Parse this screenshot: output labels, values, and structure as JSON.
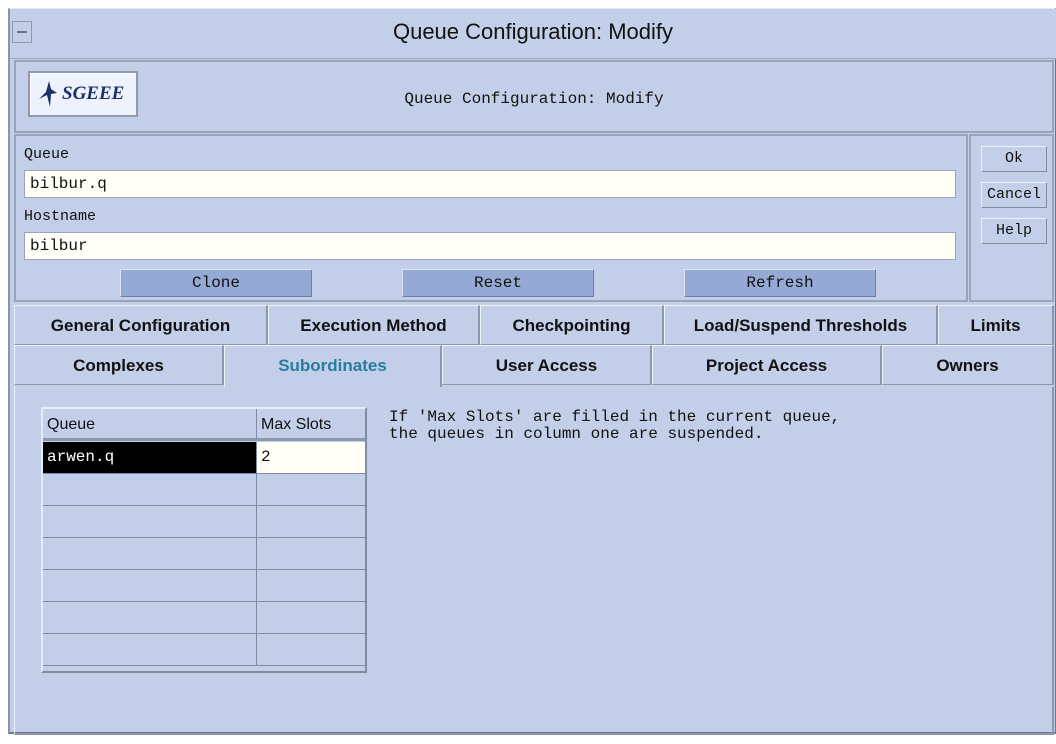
{
  "window": {
    "title": "Queue Configuration: Modify"
  },
  "header": {
    "logo_text": "SGEEE",
    "title": "Queue Configuration: Modify"
  },
  "form": {
    "queue_label": "Queue",
    "queue_value": "bilbur.q",
    "hostname_label": "Hostname",
    "hostname_value": "bilbur",
    "buttons": {
      "clone": "Clone",
      "reset": "Reset",
      "refresh": "Refresh"
    }
  },
  "side_buttons": {
    "ok": "Ok",
    "cancel": "Cancel",
    "help": "Help"
  },
  "tabs_row1": [
    "General Configuration",
    "Execution Method",
    "Checkpointing",
    "Load/Suspend Thresholds",
    "Limits"
  ],
  "tabs_row2": [
    "Complexes",
    "Subordinates",
    "User Access",
    "Project Access",
    "Owners"
  ],
  "active_tab": "Subordinates",
  "subordinates_table": {
    "columns": [
      "Queue",
      "Max Slots"
    ],
    "rows": [
      [
        "arwen.q",
        "2"
      ],
      [
        "",
        ""
      ],
      [
        "",
        ""
      ],
      [
        "",
        ""
      ],
      [
        "",
        ""
      ],
      [
        "",
        ""
      ],
      [
        "",
        ""
      ]
    ]
  },
  "hint_lines": [
    "If 'Max Slots' are filled in the current queue,",
    "the queues in column one are suspended."
  ],
  "colors": {
    "background": "#c3cfe9",
    "button": "#94a9d4",
    "active_tab_text": "#287c9e",
    "logo_text": "#1d2f6b"
  }
}
